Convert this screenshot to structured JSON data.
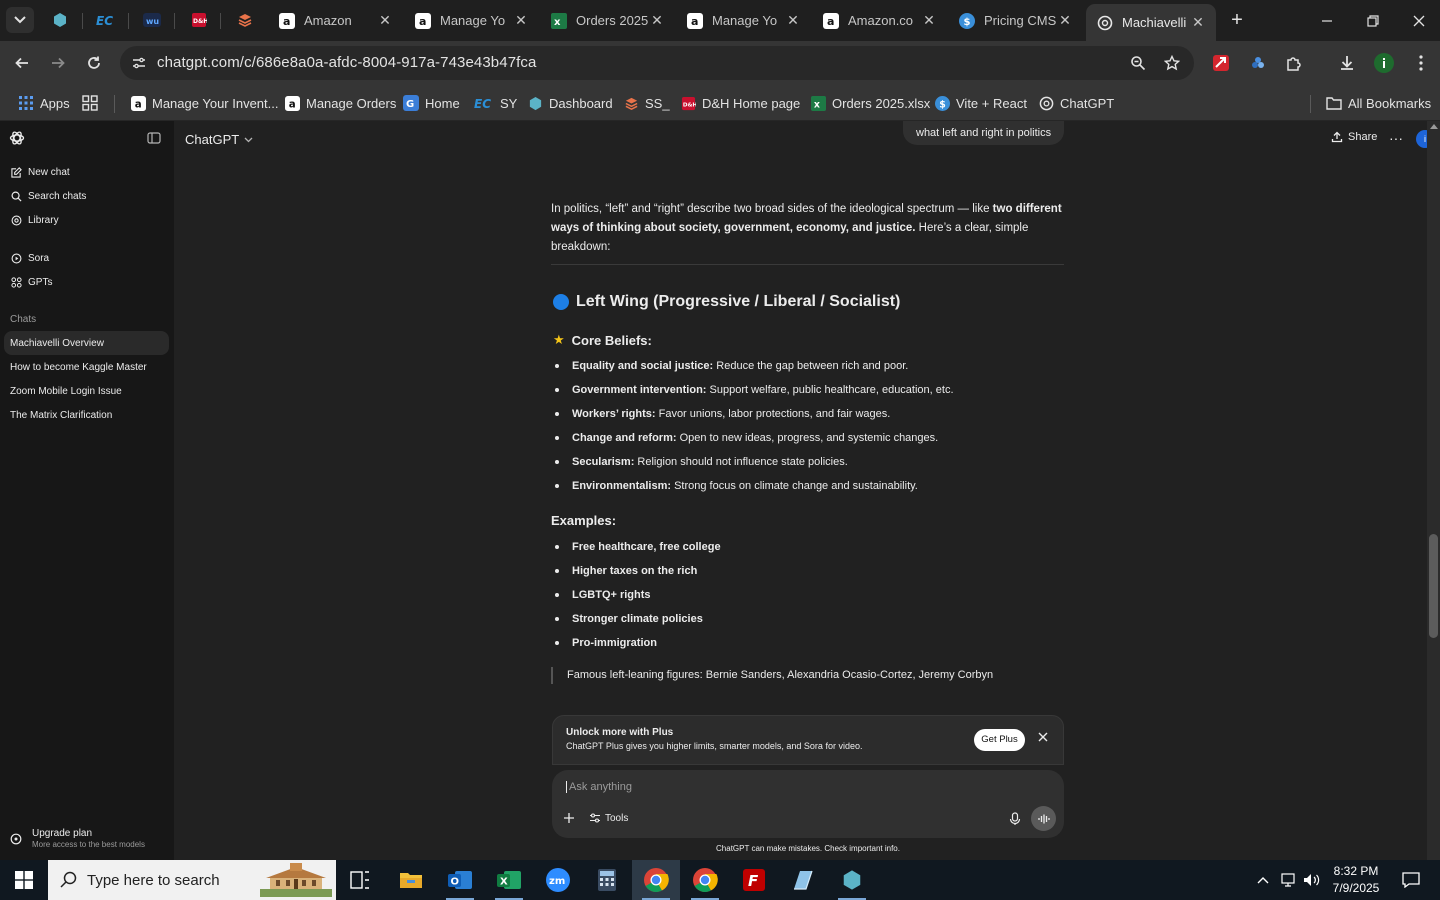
{
  "browser": {
    "tabs": [
      {
        "title": "Amazon",
        "icon": "amazon-icon"
      },
      {
        "title": "Manage Yo",
        "icon": "amazon-icon"
      },
      {
        "title": "Orders 2025",
        "icon": "excel-icon"
      },
      {
        "title": "Manage Yo",
        "icon": "amazon-icon"
      },
      {
        "title": "Amazon.co",
        "icon": "amazon-icon"
      },
      {
        "title": "Pricing CMS",
        "icon": "dollar-icon"
      },
      {
        "title": "Machiavelli",
        "icon": "chatgpt-icon"
      }
    ],
    "active_tab_index": 6,
    "url": "chatgpt.com/c/686e8a0a-afdc-8004-917a-743e43b47fca",
    "profile_initial": "i",
    "bookmarks": [
      {
        "label": "Apps"
      },
      {
        "label": "Manage Your Invent..."
      },
      {
        "label": "Manage Orders"
      },
      {
        "label": "Home"
      },
      {
        "label": "SY"
      },
      {
        "label": "Dashboard"
      },
      {
        "label": "SS_"
      },
      {
        "label": "D&H Home page"
      },
      {
        "label": "Orders 2025.xlsx"
      },
      {
        "label": "Vite + React"
      },
      {
        "label": "ChatGPT"
      }
    ],
    "all_bookmarks": "All Bookmarks"
  },
  "sidebar": {
    "nav": [
      {
        "label": "New chat",
        "icon": "new-chat-icon"
      },
      {
        "label": "Search chats",
        "icon": "search-icon"
      },
      {
        "label": "Library",
        "icon": "library-icon"
      }
    ],
    "tools": [
      {
        "label": "Sora",
        "icon": "sora-icon"
      },
      {
        "label": "GPTs",
        "icon": "gpts-icon"
      }
    ],
    "chats_heading": "Chats",
    "chats": [
      {
        "label": "Machiavelli Overview"
      },
      {
        "label": "How to become Kaggle Master"
      },
      {
        "label": "Zoom Mobile Login Issue"
      },
      {
        "label": "The Matrix Clarification"
      }
    ],
    "upgrade_title": "Upgrade plan",
    "upgrade_subtitle": "More access to the best models"
  },
  "header": {
    "model": "ChatGPT",
    "share": "Share",
    "avatar": "i"
  },
  "conversation": {
    "user_message": "what left and right in politics",
    "intro_part1": "In politics, “left” and “right” describe two broad sides of the ideological spectrum — like ",
    "intro_bold": "two different ways of thinking about society, government, economy, and justice.",
    "intro_part2": " Here’s a clear, simple breakdown:",
    "section_title": "Left Wing (Progressive / Liberal / Socialist)",
    "core_beliefs_heading": "Core Beliefs:",
    "core_beliefs": [
      {
        "term": "Equality and social justice:",
        "text": " Reduce the gap between rich and poor."
      },
      {
        "term": "Government intervention:",
        "text": " Support welfare, public healthcare, education, etc."
      },
      {
        "term": "Workers’ rights:",
        "text": " Favor unions, labor protections, and fair wages."
      },
      {
        "term": "Change and reform:",
        "text": " Open to new ideas, progress, and systemic changes."
      },
      {
        "term": "Secularism:",
        "text": " Religion should not influence state policies."
      },
      {
        "term": "Environmentalism:",
        "text": " Strong focus on climate change and sustainability."
      }
    ],
    "examples_heading": "Examples:",
    "examples": [
      "Free healthcare, free college",
      "Higher taxes on the rich",
      "LGBTQ+ rights",
      "Stronger climate policies",
      "Pro-immigration"
    ],
    "quote": "Famous left-leaning figures: Bernie Sanders, Alexandria Ocasio-Cortez, Jeremy Corbyn"
  },
  "upsell": {
    "title": "Unlock more with Plus",
    "text": "ChatGPT Plus gives you higher limits, smarter models, and Sora for video.",
    "button": "Get Plus"
  },
  "composer": {
    "placeholder": "Ask anything",
    "tools": "Tools",
    "disclaimer": "ChatGPT can make mistakes. Check important info."
  },
  "taskbar": {
    "search_placeholder": "Type here to search",
    "time": "8:32 PM",
    "date": "7/9/2025"
  },
  "colors": {
    "accent_blue": "#1d7fe6",
    "star": "#f5c518",
    "background": "#212121",
    "sidebar": "#171717"
  }
}
